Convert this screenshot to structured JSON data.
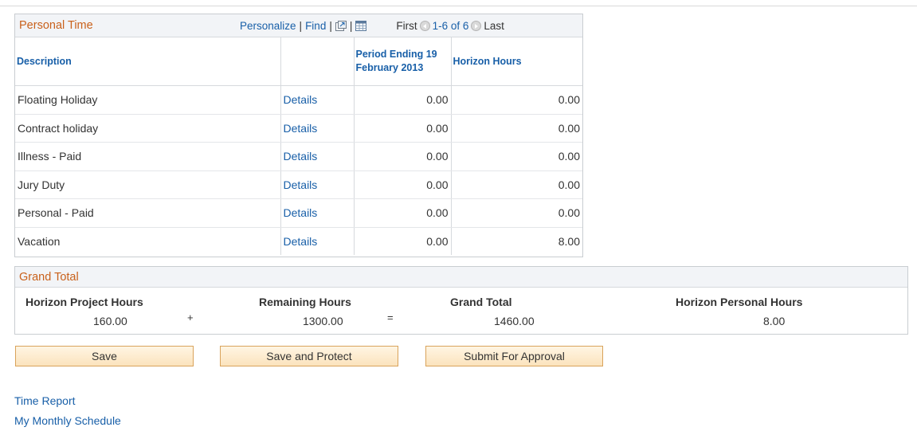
{
  "personal_time": {
    "title": "Personal Time",
    "nav": {
      "personalize": "Personalize",
      "find": "Find",
      "view_all_icon": "new-window-icon",
      "download_icon": "spreadsheet-icon",
      "first": "First",
      "range": "1-6 of 6",
      "last": "Last"
    },
    "columns": {
      "description": "Description",
      "details": "",
      "period_ending": "Period Ending 19 February 2013",
      "horizon_hours": "Horizon Hours"
    },
    "rows": [
      {
        "description": "Floating Holiday",
        "details": "Details",
        "period": "0.00",
        "horizon": "0.00"
      },
      {
        "description": "Contract holiday",
        "details": "Details",
        "period": "0.00",
        "horizon": "0.00"
      },
      {
        "description": "Illness - Paid",
        "details": "Details",
        "period": "0.00",
        "horizon": "0.00"
      },
      {
        "description": "Jury Duty",
        "details": "Details",
        "period": "0.00",
        "horizon": "0.00"
      },
      {
        "description": "Personal - Paid",
        "details": "Details",
        "period": "0.00",
        "horizon": "0.00"
      },
      {
        "description": "Vacation",
        "details": "Details",
        "period": "0.00",
        "horizon": "8.00"
      }
    ]
  },
  "grand_total": {
    "title": "Grand Total",
    "project_label": "Horizon Project Hours",
    "project_value": "160.00",
    "plus": "+",
    "remaining_label": "Remaining Hours",
    "remaining_value": "1300.00",
    "equals": "=",
    "total_label": "Grand Total",
    "total_value": "1460.00",
    "personal_label": "Horizon Personal Hours",
    "personal_value": "8.00"
  },
  "buttons": {
    "save": "Save",
    "save_protect": "Save and Protect",
    "submit": "Submit For Approval"
  },
  "links": {
    "time_report": "Time Report",
    "monthly_schedule": "My Monthly Schedule"
  },
  "colors": {
    "section_title": "#c9611b",
    "link": "#185fa8",
    "button_fill": "#fbe3bd",
    "button_border": "#d9a35b"
  }
}
